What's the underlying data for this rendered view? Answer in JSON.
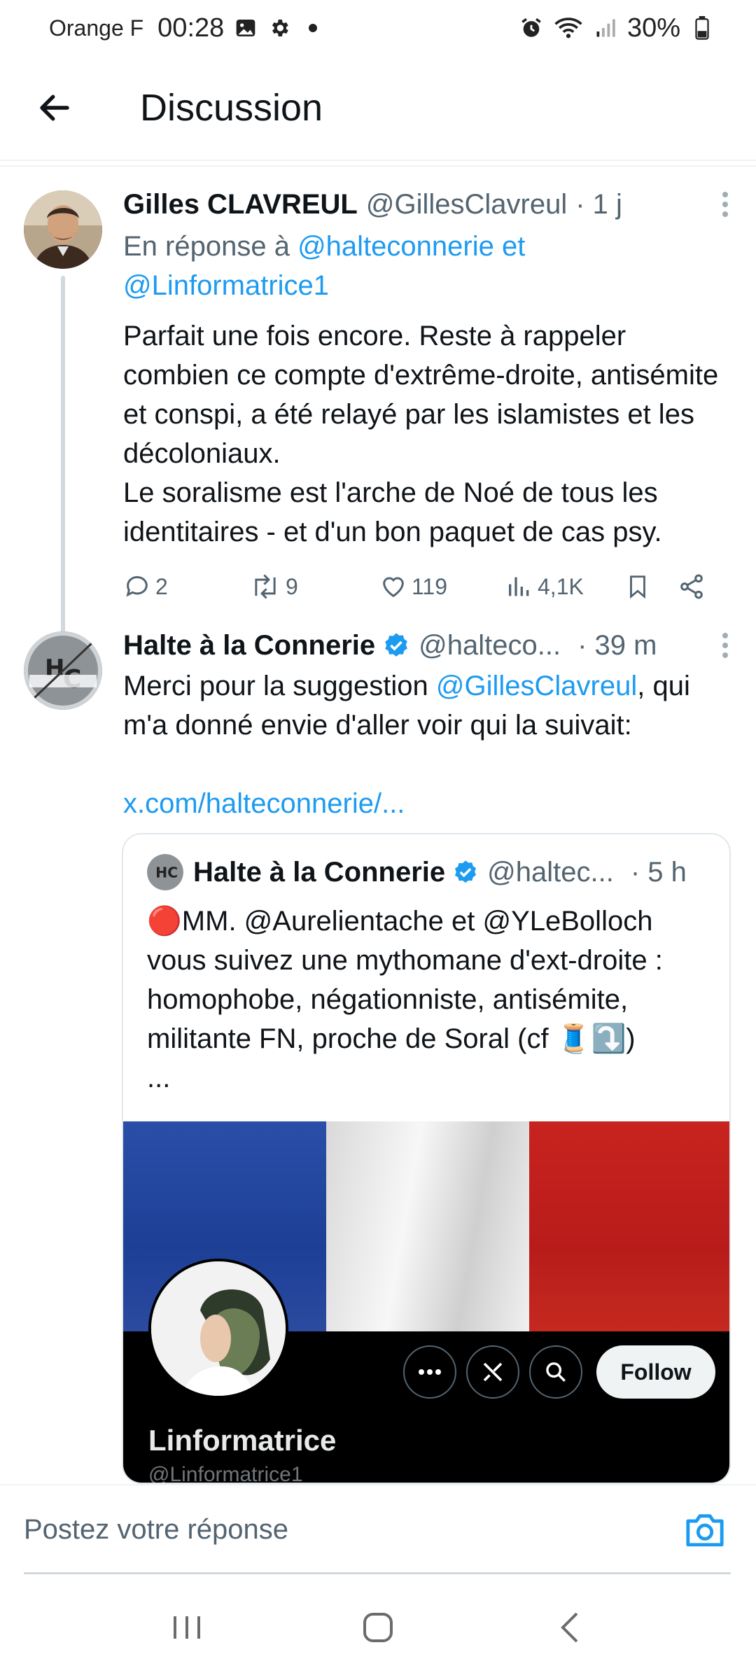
{
  "status_bar": {
    "carrier": "Orange F",
    "time": "00:28",
    "battery": "30%"
  },
  "header": {
    "title": "Discussion"
  },
  "tweets": [
    {
      "name": "Gilles CLAVREUL",
      "handle": "@GillesClavreul",
      "time": "· 1 j",
      "reply_prefix": "En réponse à",
      "reply_mention_1": "@halteconnerie et",
      "reply_mention_2": "@Linformatrice1",
      "text": "Parfait une fois encore. Reste à rappeler combien ce compte d'extrême-droite, antisémite et conspi, a été relayé par les islamistes et les décoloniaux.\nLe soralisme est l'arche de Noé de tous les identitaires - et d'un bon paquet de cas psy.",
      "replies": "2",
      "retweets": "9",
      "likes": "119",
      "views": "4,1K"
    },
    {
      "name": "Halte à la Connerie",
      "handle": "@halteco...",
      "time": "· 39 m",
      "text_before": "Merci pour la suggestion ",
      "text_mention": "@GillesClavreul",
      "text_after": ", qui m'a donné envie d'aller voir qui la suivait:",
      "link": "x.com/halteconnerie/..."
    }
  ],
  "quote": {
    "name": "Halte à la Connerie",
    "handle": "@haltec...",
    "time": "· 5 h",
    "text": "🔴MM. @Aurelientache et @YLeBolloch vous suivez une mythomane d'ext-droite : homophobe, négationniste, antisémite, militante FN, proche de Soral (cf 🧵⤵️)\n...",
    "profile": {
      "name": "Linformatrice",
      "handle": "@Linformatrice1",
      "follow_label": "Follow"
    }
  },
  "reply_bar": {
    "placeholder": "Postez votre réponse"
  },
  "colors": {
    "accent": "#1d9bf0",
    "text": "#0f1419",
    "muted": "#536471"
  }
}
